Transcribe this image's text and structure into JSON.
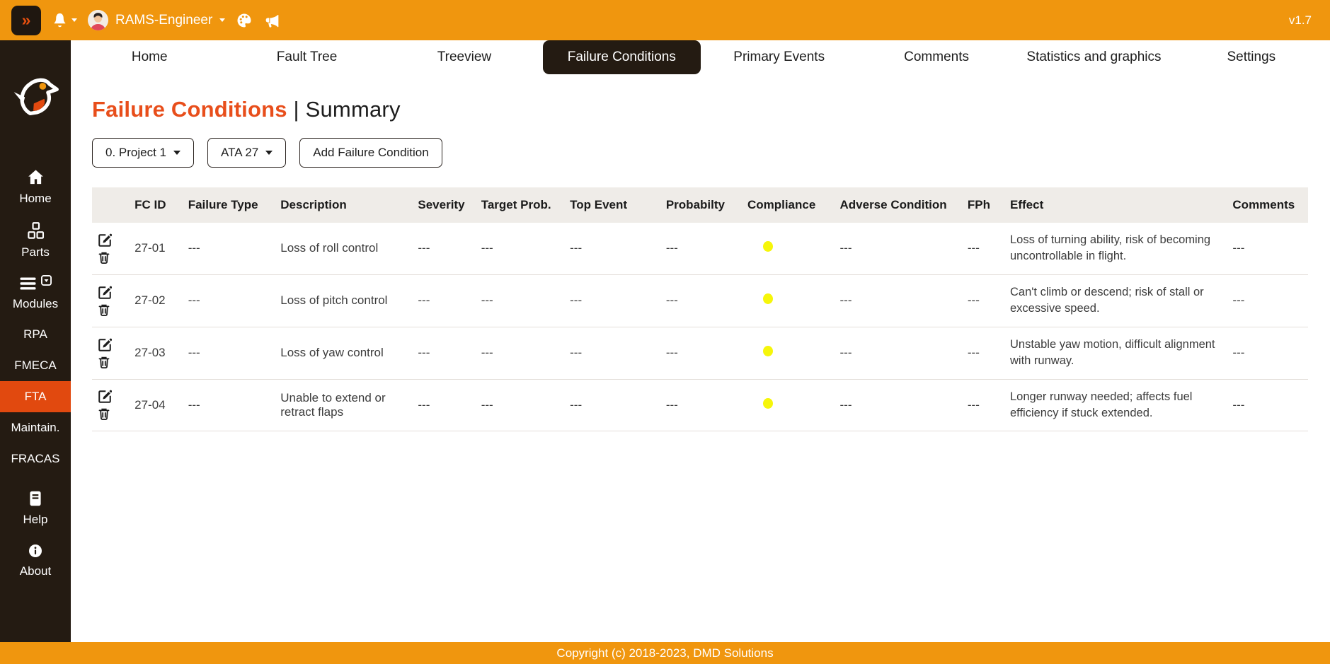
{
  "topbar": {
    "collapse_label": "»",
    "user_name": "RAMS-Engineer",
    "version": "v1.7"
  },
  "sidebar": {
    "items": [
      {
        "label": "Home"
      },
      {
        "label": "Parts"
      },
      {
        "label": "Modules"
      },
      {
        "label": "RPA"
      },
      {
        "label": "FMECA"
      },
      {
        "label": "FTA",
        "active": true
      },
      {
        "label": "Maintain."
      },
      {
        "label": "FRACAS"
      },
      {
        "label": "Help"
      },
      {
        "label": "About"
      }
    ]
  },
  "nav": {
    "tabs": [
      {
        "label": "Home"
      },
      {
        "label": "Fault Tree"
      },
      {
        "label": "Treeview"
      },
      {
        "label": "Failure Conditions",
        "active": true
      },
      {
        "label": "Primary Events"
      },
      {
        "label": "Comments"
      },
      {
        "label": "Statistics and graphics"
      },
      {
        "label": "Settings"
      }
    ]
  },
  "page": {
    "title": "Failure Conditions",
    "subtitle": "| Summary",
    "project_dropdown": "0. Project 1",
    "ata_dropdown": "ATA 27",
    "add_button": "Add Failure Condition"
  },
  "table": {
    "headers": [
      "FC ID",
      "Failure Type",
      "Description",
      "Severity",
      "Target Prob.",
      "Top Event",
      "Probabilty",
      "Compliance",
      "Adverse Condition",
      "FPh",
      "Effect",
      "Comments"
    ],
    "rows": [
      {
        "fc_id": "27-01",
        "failure_type": "---",
        "description": "Loss of roll control",
        "severity": "---",
        "target_prob": "---",
        "top_event": "---",
        "probability": "---",
        "compliance": "yellow",
        "adverse_condition": "---",
        "fph": "---",
        "effect": "Loss of turning ability, risk of becoming uncontrollable in flight.",
        "comments": "---"
      },
      {
        "fc_id": "27-02",
        "failure_type": "---",
        "description": "Loss of pitch control",
        "severity": "---",
        "target_prob": "---",
        "top_event": "---",
        "probability": "---",
        "compliance": "yellow",
        "adverse_condition": "---",
        "fph": "---",
        "effect": "Can't climb or descend; risk of stall or excessive speed.",
        "comments": "---"
      },
      {
        "fc_id": "27-03",
        "failure_type": "---",
        "description": "Loss of yaw control",
        "severity": "---",
        "target_prob": "---",
        "top_event": "---",
        "probability": "---",
        "compliance": "yellow",
        "adverse_condition": "---",
        "fph": "---",
        "effect": "Unstable yaw motion, difficult alignment with runway.",
        "comments": "---"
      },
      {
        "fc_id": "27-04",
        "failure_type": "---",
        "description": "Unable to extend or retract flaps",
        "severity": "---",
        "target_prob": "---",
        "top_event": "---",
        "probability": "---",
        "compliance": "yellow",
        "adverse_condition": "---",
        "fph": "---",
        "effect": "Longer runway needed; affects fuel efficiency if stuck extended.",
        "comments": "---"
      }
    ]
  },
  "footer": {
    "copyright": "Copyright (c) 2018-2023, DMD Solutions"
  },
  "colors": {
    "brand_orange": "#F0960E",
    "accent_red_orange": "#E84E1B",
    "active_module_bg": "#E1490F",
    "sidebar_bg": "#241B12",
    "table_header_bg": "#EFECE8",
    "compliance_yellow": "#F6F60A"
  }
}
